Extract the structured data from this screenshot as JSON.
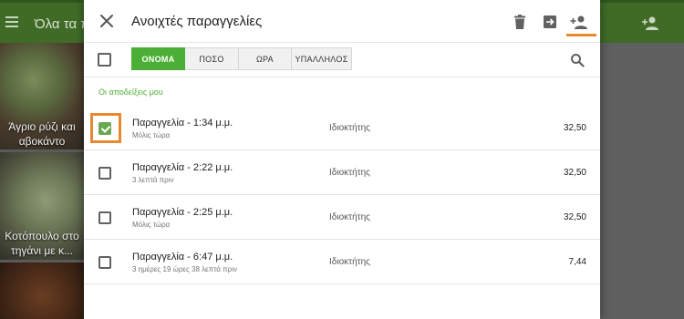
{
  "background": {
    "title": "Όλα τα πρ",
    "tiles": [
      "Άγριο ρύζι και αβοκάντο",
      "Κοτόπουλο στο τηγάνι με κ..."
    ]
  },
  "dialog": {
    "title": "Ανοιχτές παραγγελίες",
    "sort_buttons": [
      {
        "label": "ΟΝΟΜΑ",
        "active": true
      },
      {
        "label": "ΠΟΣΟ",
        "active": false
      },
      {
        "label": "ΩΡΑ",
        "active": false
      },
      {
        "label": "ΥΠΑΛΛΗΛΟΣ",
        "active": false
      }
    ],
    "section_label": "Οι αποδείξεις μου",
    "orders": [
      {
        "title": "Παραγγελία - 1:34 μ.μ.",
        "subtitle": "Μόλις τώρα",
        "owner": "Ιδιοκτήτης",
        "amount": "32,50",
        "checked": true
      },
      {
        "title": "Παραγγελία - 2:22 μ.μ.",
        "subtitle": "3 λεπτά πριν",
        "owner": "Ιδιοκτήτης",
        "amount": "32,50",
        "checked": false
      },
      {
        "title": "Παραγγελία - 2:25 μ.μ.",
        "subtitle": "Μόλις τώρα",
        "owner": "Ιδιοκτήτης",
        "amount": "32,50",
        "checked": false
      },
      {
        "title": "Παραγγελία - 6:47 μ.μ.",
        "subtitle": "3 ημέρες 19 ώρες 38 λεπτά πριν",
        "owner": "Ιδιοκτήτης",
        "amount": "7,44",
        "checked": false
      }
    ]
  },
  "colors": {
    "accent_green": "#4caf35",
    "highlight_orange": "#e8892f",
    "appbar_green": "#3f6b27"
  },
  "icons": {
    "close": "close-icon",
    "delete": "trash-icon",
    "move": "move-arrow-icon",
    "assign": "person-add-icon",
    "search": "search-icon"
  }
}
